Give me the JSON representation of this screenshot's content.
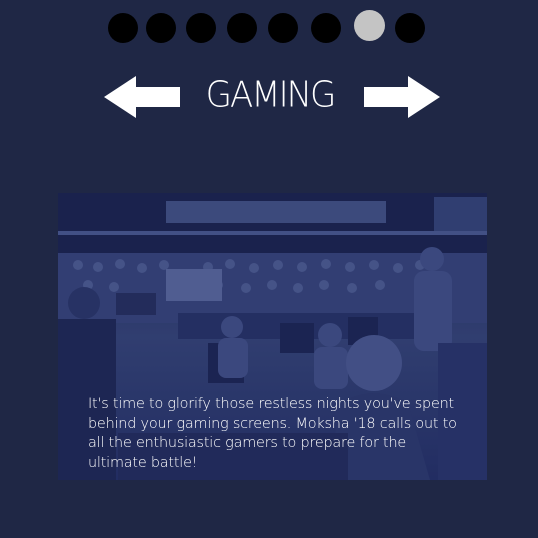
{
  "carousel": {
    "dots": [
      {
        "active": false
      },
      {
        "active": false
      },
      {
        "active": false
      },
      {
        "active": false
      },
      {
        "active": false
      },
      {
        "active": false
      },
      {
        "active": true
      },
      {
        "active": false
      }
    ],
    "active_index": 6
  },
  "header": {
    "title": "GAMING",
    "prev_icon": "arrow-left-icon",
    "next_icon": "arrow-right-icon"
  },
  "card": {
    "image": "gaming-tournament-photo",
    "caption": "It's time to glorify those restless nights you've spent behind your gaming screens. Moksha '18 calls out to all the enthusiastic gamers to prepare for the ultimate battle!"
  },
  "colors": {
    "background": "#1f2745",
    "dot": "#000000",
    "dot_active": "#c4c4c4",
    "text": "#ffffff"
  }
}
